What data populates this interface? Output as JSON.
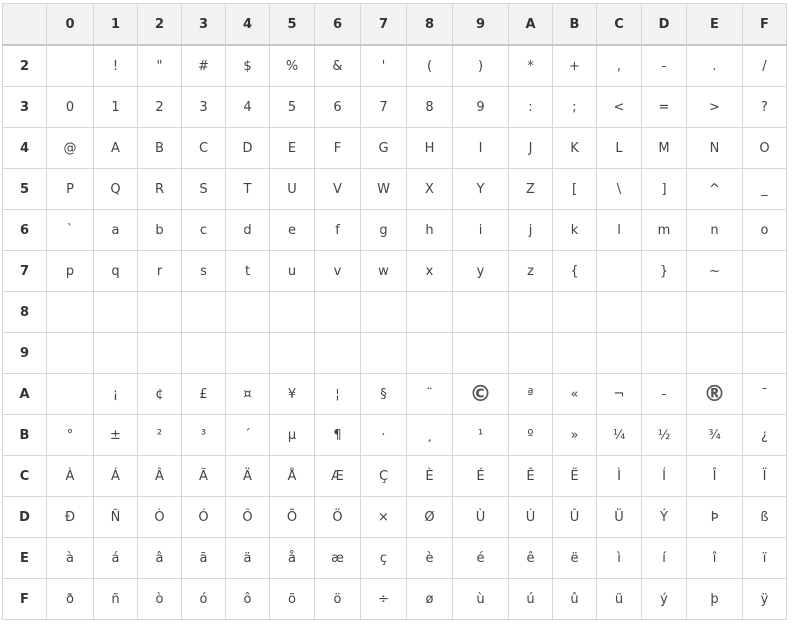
{
  "columns": [
    "",
    "0",
    "1",
    "2",
    "3",
    "4",
    "5",
    "6",
    "7",
    "8",
    "9",
    "A",
    "B",
    "C",
    "D",
    "E",
    "F"
  ],
  "rows": [
    {
      "label": "2",
      "cells": [
        "",
        "!",
        "\"",
        "#",
        "$",
        "%",
        "&",
        "'",
        "(",
        ")",
        "*",
        "+",
        ",",
        "-",
        ".",
        "/"
      ]
    },
    {
      "label": "3",
      "cells": [
        "0",
        "1",
        "2",
        "3",
        "4",
        "5",
        "6",
        "7",
        "8",
        "9",
        ":",
        ";",
        "<",
        "=",
        ">",
        "?"
      ]
    },
    {
      "label": "4",
      "cells": [
        "@",
        "A",
        "B",
        "C",
        "D",
        "E",
        "F",
        "G",
        "H",
        "I",
        "J",
        "K",
        "L",
        "M",
        "N",
        "O"
      ]
    },
    {
      "label": "5",
      "cells": [
        "P",
        "Q",
        "R",
        "S",
        "T",
        "U",
        "V",
        "W",
        "X",
        "Y",
        "Z",
        "[",
        "\\",
        "]",
        "^",
        "_"
      ]
    },
    {
      "label": "6",
      "cells": [
        "`",
        "a",
        "b",
        "c",
        "d",
        "e",
        "f",
        "g",
        "h",
        "i",
        "j",
        "k",
        "l",
        "m",
        "n",
        "o"
      ]
    },
    {
      "label": "7",
      "cells": [
        "p",
        "q",
        "r",
        "s",
        "t",
        "u",
        "v",
        "w",
        "x",
        "y",
        "z",
        "{",
        "",
        "}",
        "~",
        ""
      ]
    },
    {
      "label": "8",
      "cells": [
        "",
        "",
        "",
        "",
        "",
        "",
        "",
        "",
        "",
        "",
        "",
        "",
        "",
        "",
        "",
        ""
      ]
    },
    {
      "label": "9",
      "cells": [
        "",
        "",
        "",
        "",
        "",
        "",
        "",
        "",
        "",
        "",
        "",
        "",
        "",
        "",
        "",
        ""
      ]
    },
    {
      "label": "A",
      "cells": [
        "",
        "¡",
        "¢",
        "£",
        "¤",
        "¥",
        "¦",
        "§",
        "¨",
        "©",
        "ª",
        "«",
        "¬",
        "-",
        "®",
        "¯"
      ]
    },
    {
      "label": "B",
      "cells": [
        "°",
        "±",
        "²",
        "³",
        "´",
        "µ",
        "¶",
        "·",
        "¸",
        "¹",
        "º",
        "»",
        "¼",
        "½",
        "¾",
        "¿"
      ]
    },
    {
      "label": "C",
      "cells": [
        "À",
        "Á",
        "Â",
        "Ã",
        "Ä",
        "Å",
        "Æ",
        "Ç",
        "È",
        "É",
        "Ê",
        "Ë",
        "Ì",
        "Í",
        "Î",
        "Ï"
      ]
    },
    {
      "label": "D",
      "cells": [
        "Ð",
        "Ñ",
        "Ò",
        "Ó",
        "Ô",
        "Õ",
        "Ö",
        "×",
        "Ø",
        "Ù",
        "Ú",
        "Û",
        "Ü",
        "Ý",
        "Þ",
        "ß"
      ]
    },
    {
      "label": "E",
      "cells": [
        "à",
        "á",
        "â",
        "ã",
        "ä",
        "å",
        "æ",
        "ç",
        "è",
        "é",
        "ê",
        "ë",
        "ì",
        "í",
        "î",
        "ï"
      ]
    },
    {
      "label": "F",
      "cells": [
        "ð",
        "ñ",
        "ò",
        "ó",
        "ô",
        "õ",
        "ö",
        "÷",
        "ø",
        "ù",
        "ú",
        "û",
        "ü",
        "ý",
        "þ",
        "ÿ"
      ]
    }
  ]
}
